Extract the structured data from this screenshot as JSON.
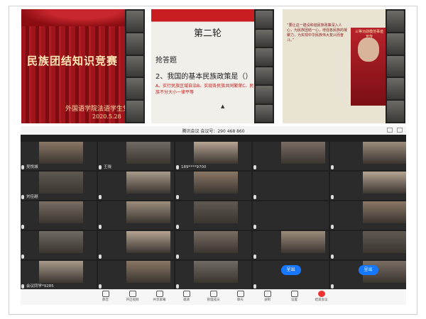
{
  "slide1": {
    "title": "民族团结知识竞赛",
    "org": "外国语学院法语学生党支部",
    "date": "2020.5.28"
  },
  "slide2": {
    "round": "第二轮",
    "type": "抢答题",
    "question": "2、我国的基本民族政策是（）",
    "options": "A、实行民族区域自治B、实现各民族共同繁荣C、民族不分大小一律平等"
  },
  "slide3": {
    "text": "“要让这一建设和谐民族政策深入人心，为民族团结一心，增强各民族的凝聚力，为实现中华民族伟大复兴而奋斗。”",
    "poster": "三等功勋模范事迹宣传"
  },
  "meeting": {
    "title": "腾讯会议  会议号：290 468 860",
    "participants": [
      "吴悦城",
      "王晓",
      "189****9700",
      "",
      "",
      "刘佳越",
      "",
      "",
      "",
      "",
      "",
      "",
      "",
      "",
      "",
      "",
      "",
      "",
      "",
      "",
      "会议同学*9285",
      "",
      "",
      "",
      ""
    ],
    "buttons": {
      "join1": "呈出",
      "join2": "呈出"
    },
    "toolbar": [
      "静音",
      "开启视频",
      "共享屏幕",
      "邀请",
      "管理成员",
      "聊天",
      "录制",
      "设置",
      "结束会议"
    ]
  }
}
